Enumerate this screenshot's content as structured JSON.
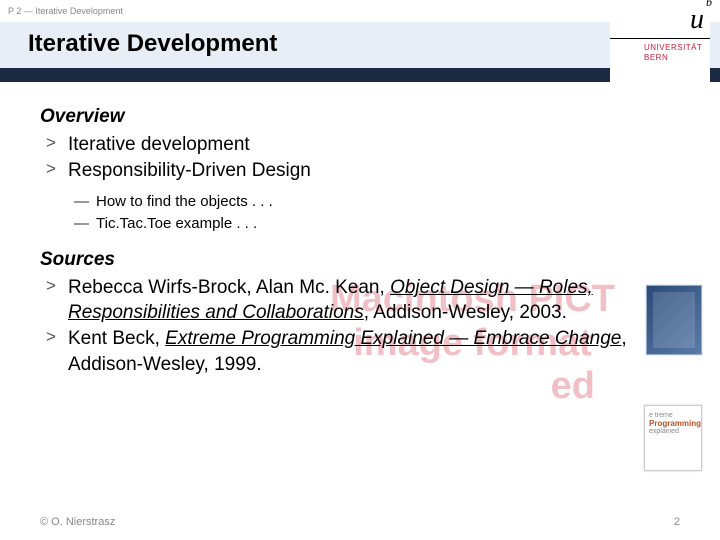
{
  "header": {
    "course_label": "P 2 — Iterative Development",
    "title": "Iterative Development"
  },
  "logo": {
    "mark": "u",
    "sup": "b",
    "line1": "UNIVERSITÄT",
    "line2": "BERN"
  },
  "overview": {
    "heading": "Overview",
    "items": [
      "Iterative development",
      "Responsibility-Driven Design"
    ],
    "subitems": [
      "How to find the objects . . .",
      "Tic.Tac.Toe example . . ."
    ]
  },
  "ghost": {
    "line1": "Macintosh PICT",
    "line2": "image format",
    "line3": "ed"
  },
  "sources": {
    "heading": "Sources",
    "items": [
      {
        "prefix": "Rebecca Wirfs-Brock, Alan Mc. Kean, ",
        "title": "Object Design — Roles, Responsibilities and Collaborations",
        "suffix": ", Addison-Wesley, 2003."
      },
      {
        "prefix": "Kent Beck, ",
        "title": "Extreme Programming Explained — Embrace Change",
        "suffix": ", Addison-Wesley, 1999."
      }
    ]
  },
  "thumb2": {
    "small": "e treme",
    "title": "Programming",
    "sub": "explained"
  },
  "footer": {
    "copyright": "© O. Nierstrasz",
    "page": "2"
  }
}
